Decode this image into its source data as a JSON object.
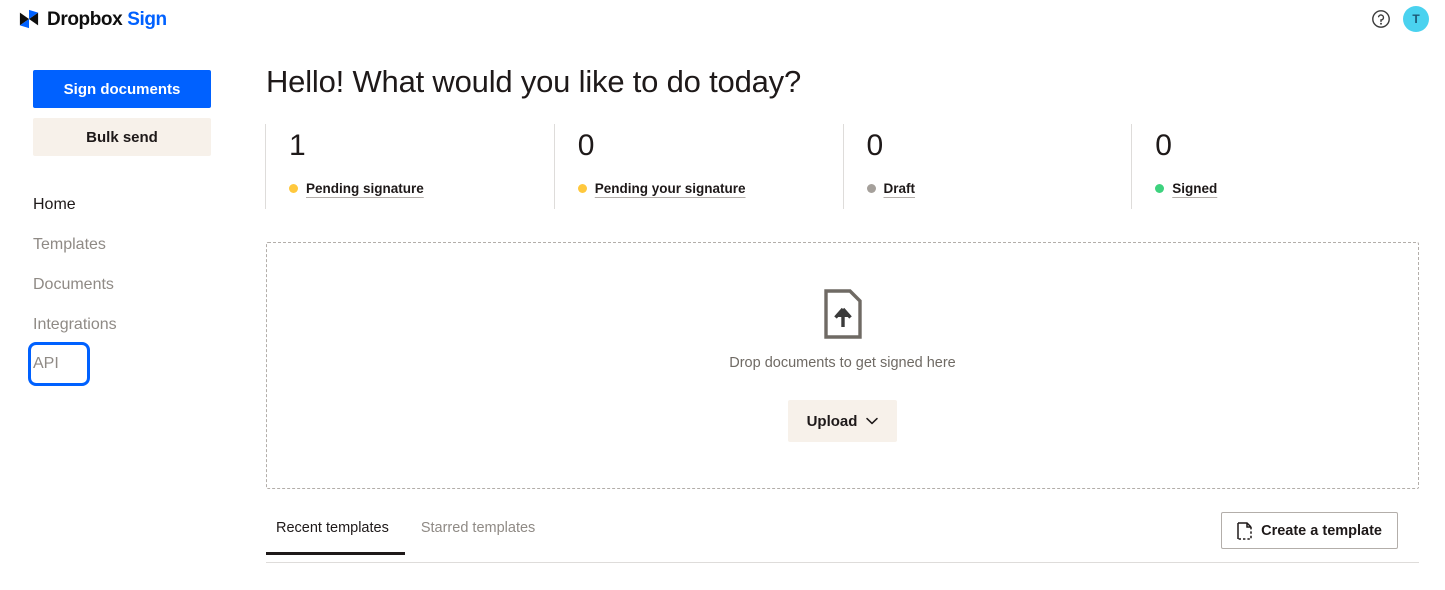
{
  "brand": {
    "name_bold": "Dropbox",
    "name_accent": "Sign",
    "accent_color": "#0061ff",
    "logo_icon": "dropbox-bowtie-icon"
  },
  "topbar": {
    "help_icon": "help-circle-icon",
    "avatar_initial": "T",
    "avatar_color": "#4ad2ef"
  },
  "sidebar": {
    "primary_button": "Sign documents",
    "secondary_button": "Bulk send",
    "items": [
      {
        "label": "Home",
        "state": "active"
      },
      {
        "label": "Templates",
        "state": "default"
      },
      {
        "label": "Documents",
        "state": "default"
      },
      {
        "label": "Integrations",
        "state": "default"
      },
      {
        "label": "API",
        "state": "focused"
      }
    ]
  },
  "main": {
    "title": "Hello! What would you like to do today?",
    "stats": [
      {
        "value": "1",
        "label": "Pending signature",
        "dot_color": "#ffc83d"
      },
      {
        "value": "0",
        "label": "Pending your signature",
        "dot_color": "#ffc83d"
      },
      {
        "value": "0",
        "label": "Draft",
        "dot_color": "#a5a09b"
      },
      {
        "value": "0",
        "label": "Signed",
        "dot_color": "#3dd27e"
      }
    ],
    "dropzone": {
      "icon": "document-upload-icon",
      "text": "Drop documents to get signed here",
      "upload_label": "Upload",
      "upload_chevron": "chevron-down-icon"
    },
    "tabs": [
      {
        "label": "Recent templates",
        "active": true
      },
      {
        "label": "Starred templates",
        "active": false
      }
    ],
    "create_template": {
      "label": "Create a template",
      "icon": "new-document-icon"
    }
  }
}
